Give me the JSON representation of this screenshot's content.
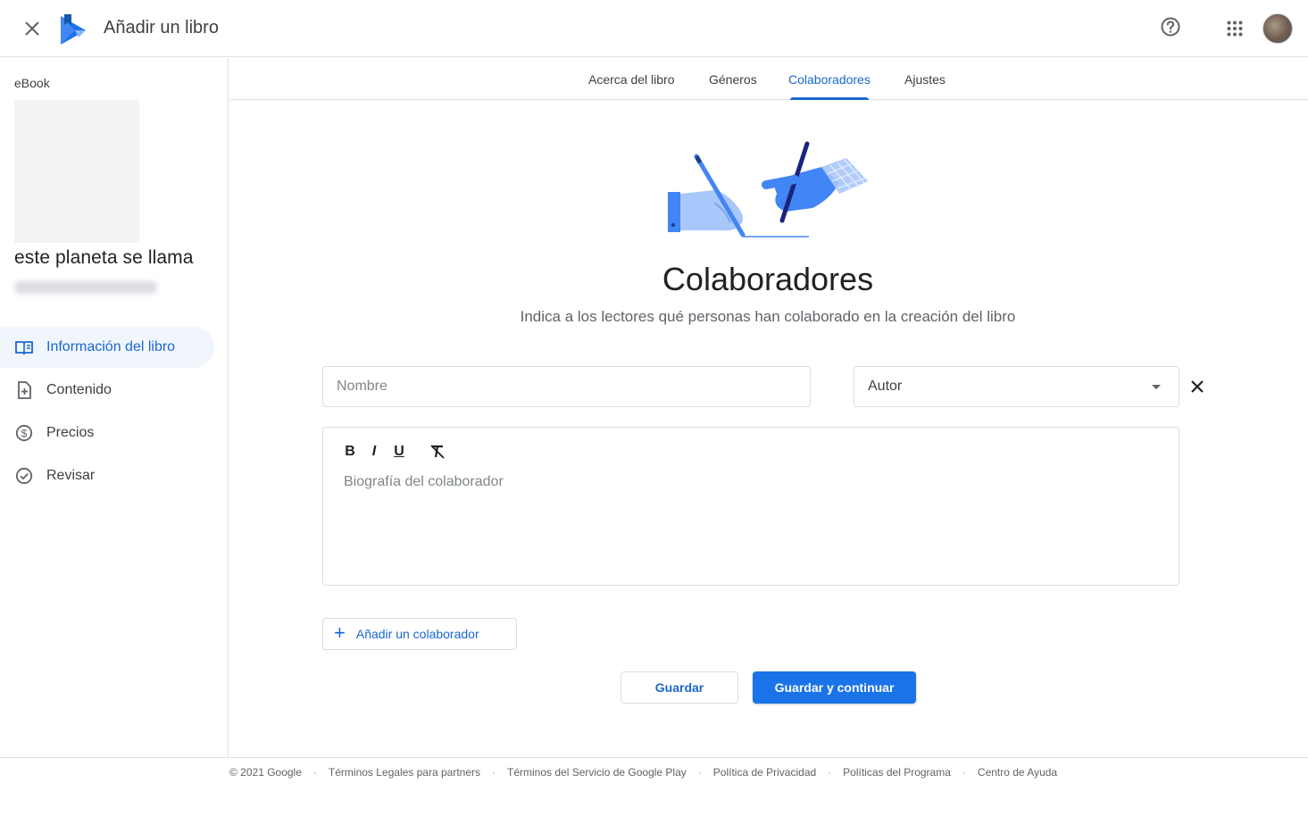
{
  "header": {
    "title": "Añadir un libro",
    "icons": {
      "close": "close-icon",
      "logo": "play-books-logo",
      "help": "help-icon",
      "apps": "apps-grid-icon",
      "avatar": "account-avatar"
    }
  },
  "sidebar": {
    "format_label": "eBook",
    "book_title": "este planeta se llama",
    "nav": [
      {
        "label": "Información del libro",
        "icon": "book-open-icon",
        "active": true
      },
      {
        "label": "Contenido",
        "icon": "file-add-icon",
        "active": false
      },
      {
        "label": "Precios",
        "icon": "dollar-circle-icon",
        "active": false
      },
      {
        "label": "Revisar",
        "icon": "check-circle-icon",
        "active": false
      }
    ]
  },
  "tabs": [
    {
      "label": "Acerca del libro",
      "active": false
    },
    {
      "label": "Géneros",
      "active": false
    },
    {
      "label": "Colaboradores",
      "active": true
    },
    {
      "label": "Ajustes",
      "active": false
    }
  ],
  "main": {
    "heading": "Colaboradores",
    "subtitle": "Indica a los lectores qué personas han colaborado en la creación del libro",
    "name_placeholder": "Nombre",
    "name_value": "",
    "role_selected": "Autor",
    "editor_toolbar": [
      "B",
      "I",
      "U",
      "clear-format"
    ],
    "bio_placeholder": "Biografía del colaborador",
    "add_collaborator_label": "Añadir un colaborador",
    "save_label": "Guardar",
    "save_continue_label": "Guardar y continuar"
  },
  "footer": {
    "copyright": "© 2021 Google",
    "links": [
      "Términos Legales para partners",
      "Términos del Servicio de Google Play",
      "Política de Privacidad",
      "Políticas del Programa",
      "Centro de Ayuda"
    ]
  },
  "colors": {
    "accent": "#1a73e8",
    "accent_text": "#1967d2",
    "border": "#dadce0",
    "nav_active_bg": "#f1f6fd"
  }
}
